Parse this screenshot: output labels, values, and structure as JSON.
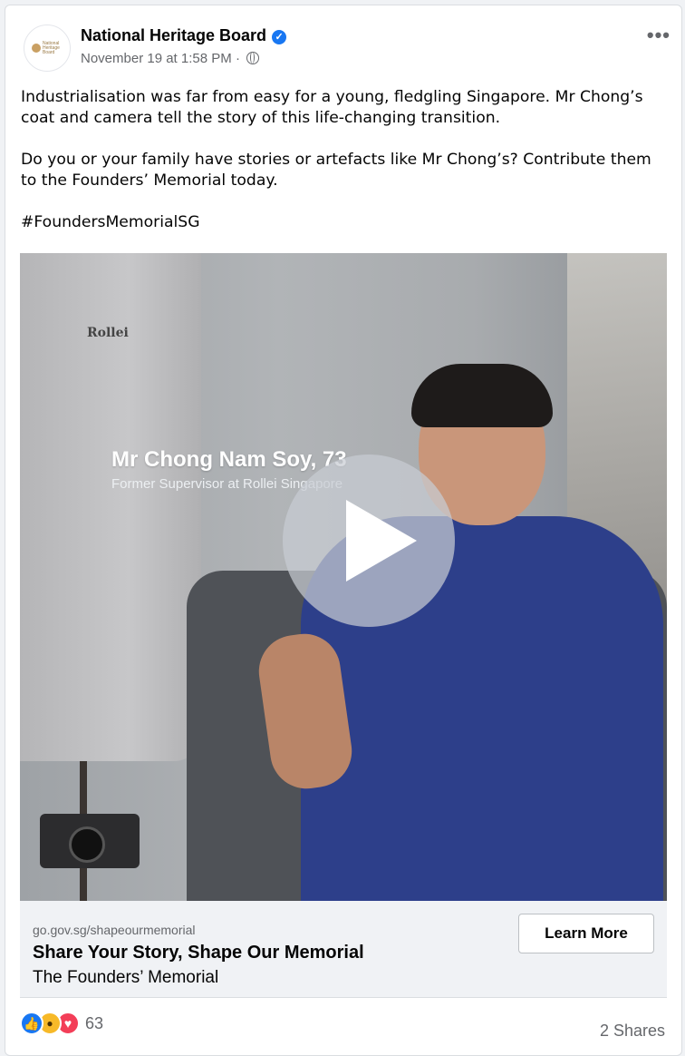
{
  "post": {
    "page_name": "National Heritage Board",
    "timestamp": "November 19 at 1:58 PM",
    "separator": "·",
    "avatar_text": "National Heritage Board",
    "paragraphs": [
      "Industrialisation was far from easy for a young, fledgling Singapore. Mr Chong’s coat and camera tell the story of this life-changing transition.",
      "Do you or your family have stories or artefacts like Mr Chong’s? Contribute them to the Founders’ Memorial today.",
      "#FoundersMemorialSG"
    ],
    "more_icon": "more-options-icon",
    "verified_icon": "verified-badge-icon"
  },
  "video": {
    "coat_label": "Rollei",
    "caption_name": "Mr Chong Nam Soy, 73",
    "caption_role": "Former Supervisor at Rollei Singapore",
    "play_icon": "play-icon"
  },
  "link_preview": {
    "domain": "go.gov.sg/shapeourmemorial",
    "title": "Share Your Story, Shape Our Memorial",
    "description": "The Founders’ Memorial",
    "cta_label": "Learn More"
  },
  "engagement": {
    "reaction_count": "63",
    "shares": "2 Shares",
    "reaction_icons": [
      "like-icon",
      "wow-icon",
      "love-icon"
    ]
  },
  "colors": {
    "brand_blue": "#1877f2",
    "love_red": "#f33e58",
    "wow_yellow": "#f7b928"
  }
}
